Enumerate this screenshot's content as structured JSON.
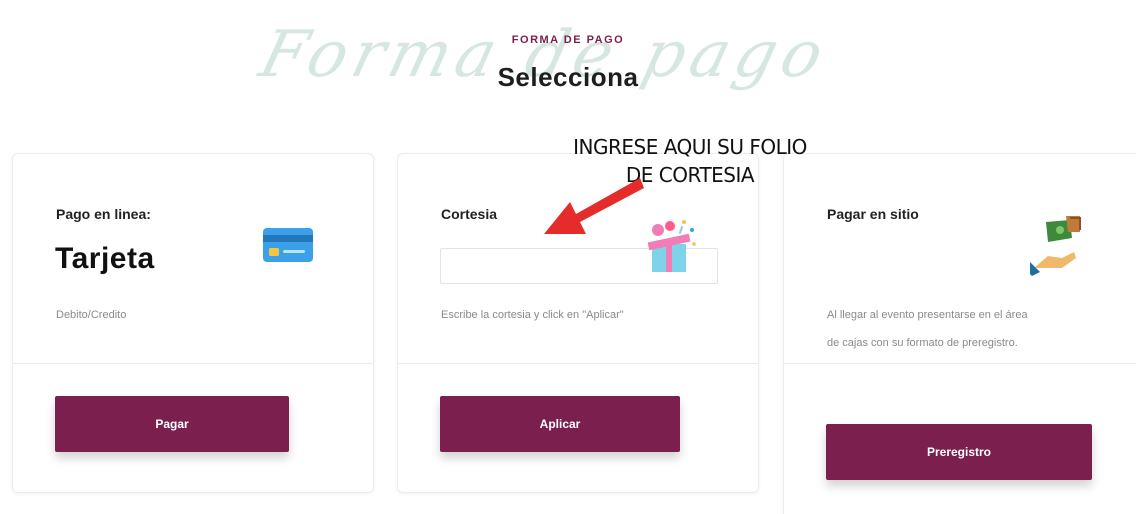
{
  "header": {
    "background_script": "Forma de pago",
    "overline": "FORMA DE PAGO",
    "title": "Selecciona"
  },
  "annotation": {
    "line1": "INGRESE AQUI SU FOLIO",
    "line2": "DE CORTESIA",
    "arrow_color": "#e62b2b"
  },
  "cards": {
    "online": {
      "label": "Pago en linea:",
      "method": "Tarjeta",
      "subtext": "Debito/Credito",
      "button": "Pagar",
      "icon": "credit-card-icon"
    },
    "courtesy": {
      "label": "Cortesia",
      "input_value": "",
      "subtext": "Escribe la cortesia y click en \"Aplicar\"",
      "button": "Aplicar",
      "icon": "gift-icon"
    },
    "onsite": {
      "label": "Pagar en sitio",
      "subtext_line1": "Al llegar al evento presentarse en el área",
      "subtext_line2": "de cajas con su formato de preregistro.",
      "button": "Preregistro",
      "icon": "cash-hand-icon"
    }
  },
  "colors": {
    "primary": "#7a1f4e",
    "script_bg": "#cfe3dc"
  }
}
